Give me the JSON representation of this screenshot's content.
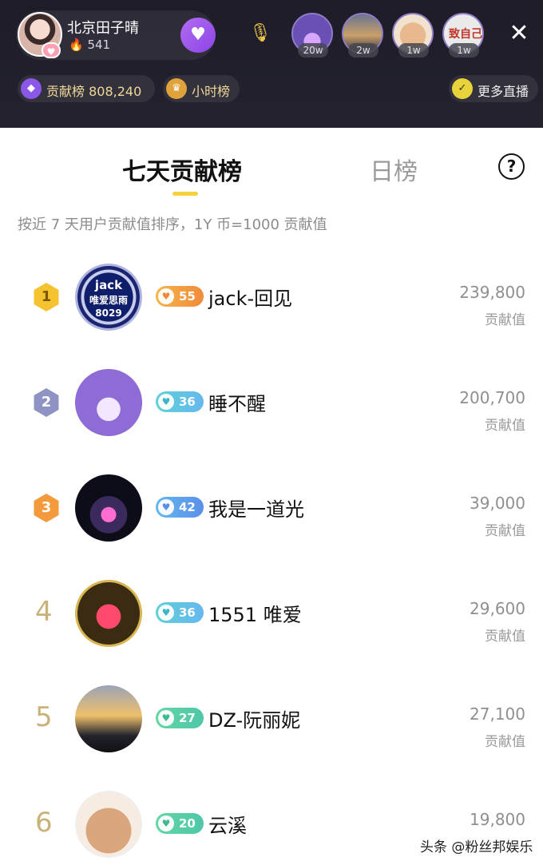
{
  "header": {
    "anchor_name": "北京田子晴",
    "anchor_fans": "541",
    "viewers": [
      {
        "badge": "20w"
      },
      {
        "badge": "2w"
      },
      {
        "badge": "1w"
      },
      {
        "badge": "1w",
        "text": "致自己"
      }
    ],
    "contribution_label": "贡献榜 808,240",
    "hourly_label": "小时榜",
    "more_live_label": "更多直播"
  },
  "tabs": {
    "week": "七天贡献榜",
    "day": "日榜",
    "help": "?"
  },
  "description": "按近 7 天用户贡献值排序，1Y 币=1000 贡献值",
  "score_unit": "贡献值",
  "ranking": [
    {
      "rank": "1",
      "level": "55",
      "name": "jack-回见",
      "score": "239,800",
      "avatar_text": [
        "jack",
        "唯爱思雨",
        "8029"
      ]
    },
    {
      "rank": "2",
      "level": "36",
      "name": "睡不醒",
      "score": "200,700"
    },
    {
      "rank": "3",
      "level": "42",
      "name": "我是一道光",
      "score": "39,000"
    },
    {
      "rank": "4",
      "level": "36",
      "name": "1551 唯爱",
      "score": "29,600"
    },
    {
      "rank": "5",
      "level": "27",
      "name": "DZ-阮丽妮",
      "score": "27,100"
    },
    {
      "rank": "6",
      "level": "20",
      "name": "云溪",
      "score": "19,800"
    }
  ],
  "watermark": "头条 @粉丝邦娱乐",
  "colors": {
    "accent_yellow": "#f6d13a",
    "header_bg": "#1d1c28",
    "rank_gold": "#f5c230",
    "rank_silver": "#8e93c4",
    "rank_bronze": "#f29a3c"
  }
}
